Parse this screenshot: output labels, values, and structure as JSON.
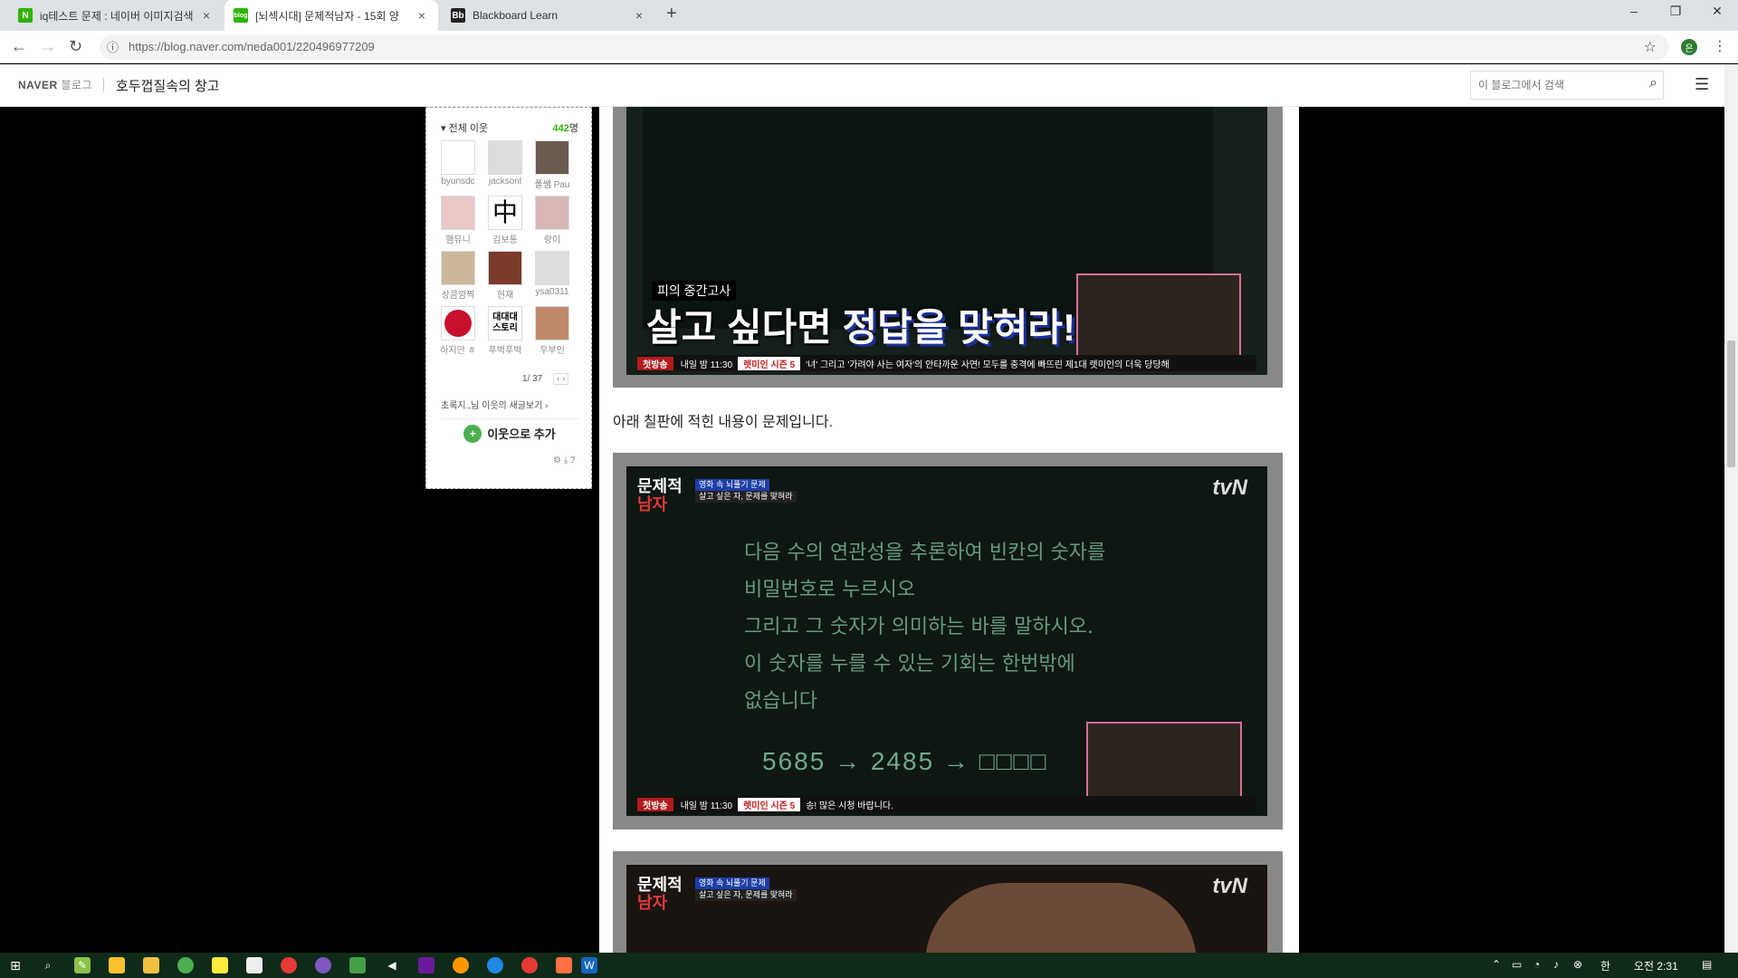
{
  "browser": {
    "tabs": [
      {
        "title": "iq테스트 문제 : 네이버 이미지검색",
        "favicon": "N",
        "favicon_color": "#2db400",
        "active": false
      },
      {
        "title": "[뇌섹시대] 문제적남자 - 15회 양",
        "favicon": "blog",
        "favicon_color": "#2db400",
        "active": true
      },
      {
        "title": "Blackboard Learn",
        "favicon": "Bb",
        "favicon_color": "#222222",
        "active": false
      }
    ],
    "url": "https://blog.naver.com/neda001/220496977209",
    "profile_initial": "은"
  },
  "blog": {
    "brand": "NAVER",
    "brand_sub": "블로그",
    "title": "호두껍질속의 창고",
    "search_placeholder": "이 블로그에서 검색"
  },
  "neighbors": {
    "header": "전체 이웃",
    "count": "442",
    "count_unit": "명",
    "items": [
      {
        "name": "byunsdc"
      },
      {
        "name": "jacksonl"
      },
      {
        "name": "폴쌤 Pau"
      },
      {
        "name": "햄뮤니"
      },
      {
        "name": "김보통"
      },
      {
        "name": "랑이"
      },
      {
        "name": "상콤깜찍"
      },
      {
        "name": "현재"
      },
      {
        "name": "ysa0311"
      },
      {
        "name": "하지만 ㅎ"
      },
      {
        "name": "푸벅푸벅"
      },
      {
        "name": "우부인"
      }
    ],
    "page": "1/ 37",
    "message": "초록지.,님 이웃의 새글보기 ›",
    "add_button": "이웃으로 추가"
  },
  "post": {
    "image1": {
      "subcaption": "피의 중간고사",
      "caption_a": "살고 싶다면 ",
      "caption_b": "정답을 맞혀라!",
      "ticker_badge": "첫방송",
      "ticker_time": "내일 밤 11:30",
      "ticker_show": "렛미인 시즌 5",
      "ticker_text": "'녀' 그리고 '가려야 사는 여자'의 안타까운 사연! 모두를 충격에 빠뜨린 제1대 렛미인의 더욱 당당해"
    },
    "caption": "아래 칠판에 적힌 내용이 문제입니다.",
    "image2": {
      "show_logo_a": "문제적",
      "show_logo_b": "남자",
      "badge_a": "영화 속 뇌풀기 문제",
      "badge_b": "살고 싶은 자, 문제를 맞혀라",
      "channel": "tvN",
      "board_lines": [
        "다음 수의 연관성을 추론하여 빈칸의 숫자를",
        "비밀번호로 누르시오",
        "그리고 그 숫자가 의미하는 바를 말하시오.",
        "이 숫자를 누를 수 있는 기회는 한번밖에",
        "없습니다"
      ],
      "equation": "5685 → 2485 → □□□□",
      "ticker_badge": "첫방송",
      "ticker_time": "내일 밤 11:30",
      "ticker_show": "렛미인 시즌 5",
      "ticker_text": "송! 많은 시청 바랍니다."
    },
    "image3": {
      "show_logo_a": "문제적",
      "show_logo_b": "남자",
      "badge_a": "영화 속 뇌풀기 문제",
      "badge_b": "살고 싶은 자, 문제를 맞혀라",
      "channel": "tvN"
    }
  },
  "taskbar": {
    "time": "오전 2:31"
  }
}
